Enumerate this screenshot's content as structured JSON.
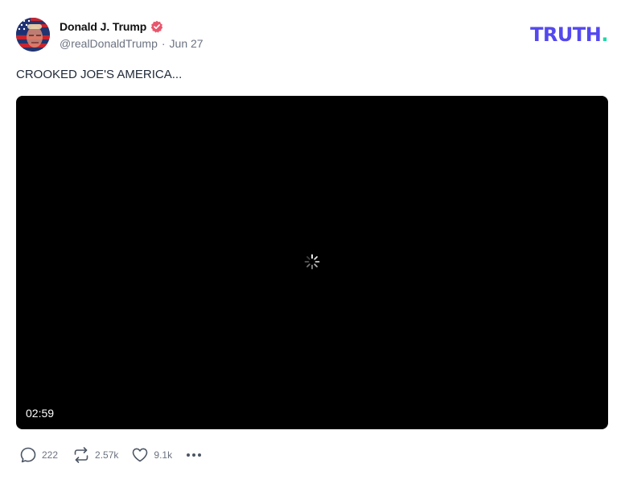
{
  "post": {
    "display_name": "Donald J. Trump",
    "handle": "@realDonaldTrump",
    "separator": "·",
    "date": "Jun 27",
    "text": "CROOKED JOE'S AMERICA...",
    "avatar_icon": "flag-portrait-avatar",
    "verified_icon": "verified-badge-icon",
    "verified_color": "#e8566b"
  },
  "brand": {
    "logo_text": "TRUTH",
    "logo_dot": ".",
    "logo_color": "#5448ee",
    "dot_color": "#1fd8a6"
  },
  "video": {
    "duration": "02:59",
    "state_icon": "loading-spinner-icon"
  },
  "actions": {
    "replies": "222",
    "retruths": "2.57k",
    "likes": "9.1k",
    "reply_icon": "reply-icon",
    "retruth_icon": "retruth-icon",
    "like_icon": "heart-icon",
    "more_icon": "more-dots-icon"
  }
}
